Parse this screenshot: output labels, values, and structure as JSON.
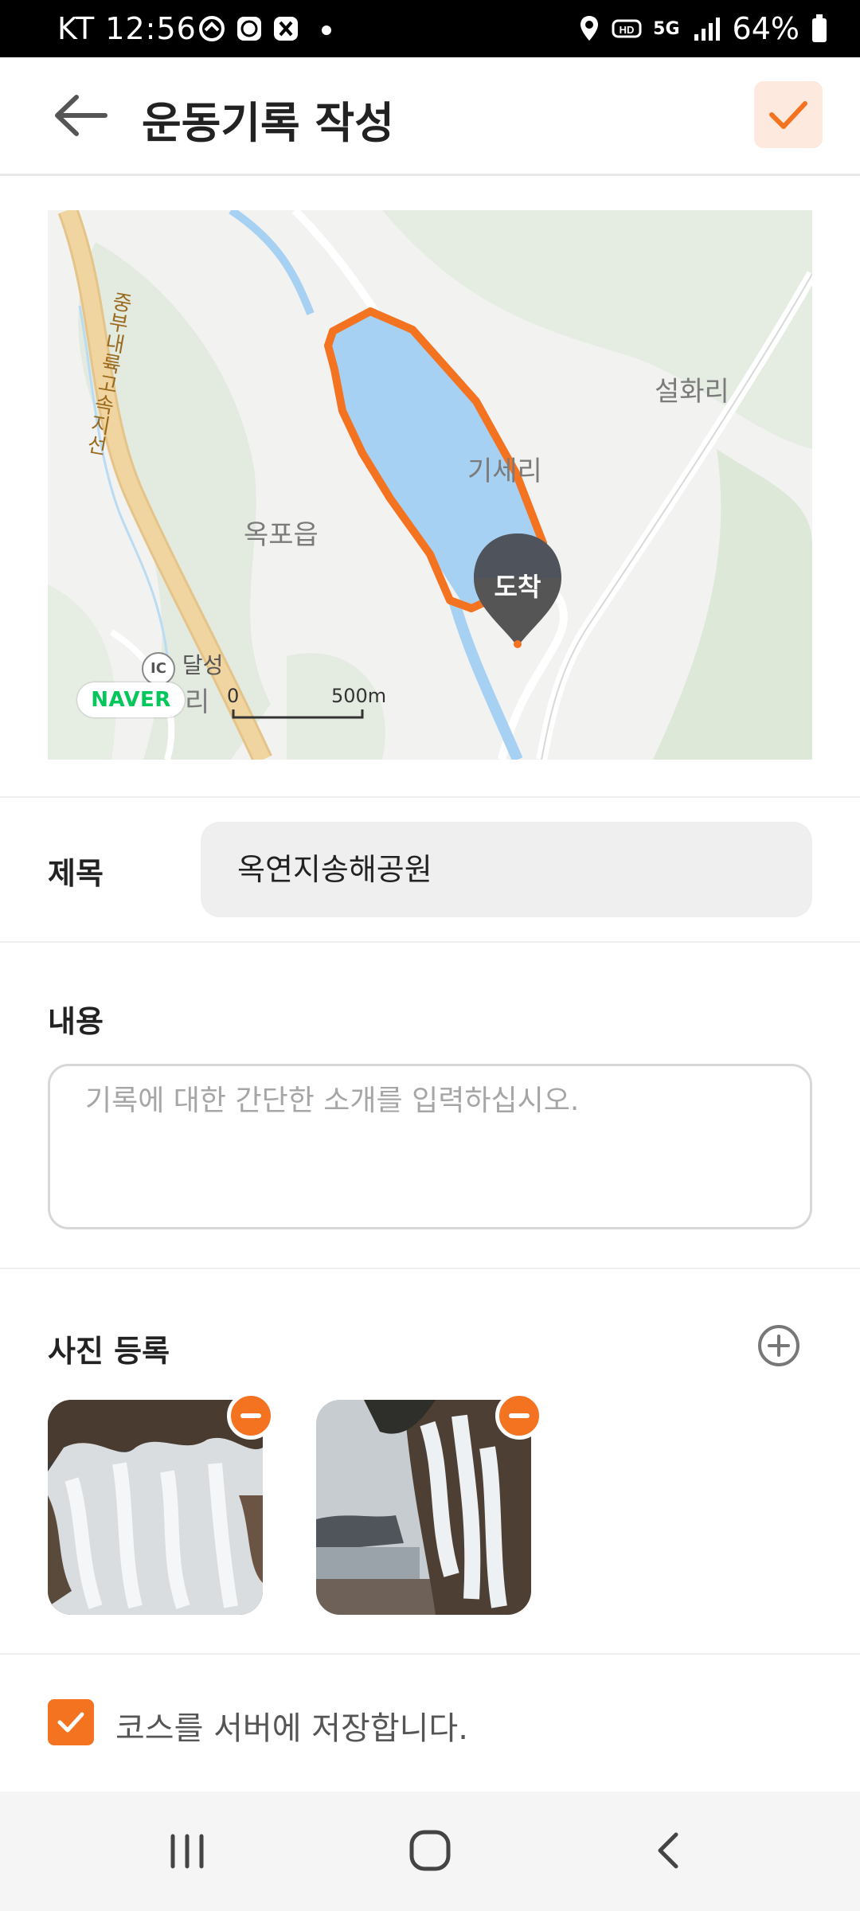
{
  "status_bar": {
    "carrier": "KT",
    "time": "12:56",
    "battery": "64%",
    "network": "5G"
  },
  "header": {
    "title": "운동기록 작성"
  },
  "map": {
    "labels": {
      "highway": "중부내륙고속지선",
      "village_east": "설화리",
      "village_center": "기세리",
      "town": "옥포읍",
      "ic": "달성",
      "ic_badge": "IC",
      "ri": "리"
    },
    "marker_label": "도착",
    "brand": "NAVER",
    "scale_start": "0",
    "scale_end": "500m"
  },
  "form": {
    "title_label": "제목",
    "title_value": "옥연지송해공원",
    "content_label": "내용",
    "content_placeholder": "기록에 대한 간단한 소개를 입력하십시오.",
    "photo_label": "사진 등록",
    "save_course_label": "코스를 서버에 저장합니다.",
    "save_course_checked": true
  },
  "colors": {
    "accent": "#f47321",
    "route": "#f47321",
    "water": "#a6d1f2",
    "marker": "#555555"
  },
  "icons": {
    "back": "arrow-left-icon",
    "confirm": "check-icon",
    "add_photo": "plus-circle-icon",
    "remove_photo": "minus-circle-icon"
  }
}
